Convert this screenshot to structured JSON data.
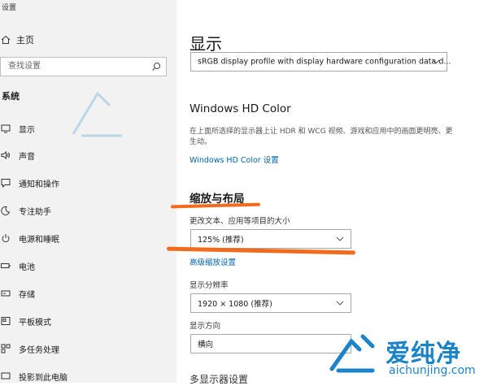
{
  "app_title": "设置",
  "home_label": "主页",
  "search_placeholder": "查找设置",
  "section_title": "系统",
  "nav": [
    {
      "label": "显示",
      "icon": "monitor-icon"
    },
    {
      "label": "声音",
      "icon": "speaker-icon"
    },
    {
      "label": "通知和操作",
      "icon": "notification-icon"
    },
    {
      "label": "专注助手",
      "icon": "moon-icon"
    },
    {
      "label": "电源和睡眠",
      "icon": "power-icon"
    },
    {
      "label": "电池",
      "icon": "battery-icon"
    },
    {
      "label": "存储",
      "icon": "storage-icon"
    },
    {
      "label": "平板模式",
      "icon": "tablet-icon"
    },
    {
      "label": "多任务处理",
      "icon": "multitask-icon"
    },
    {
      "label": "投影到此电脑",
      "icon": "project-icon"
    }
  ],
  "main": {
    "title": "显示",
    "color_profile_value": "sRGB display profile with display hardware configuration data d...",
    "hd_color_heading": "Windows HD Color",
    "hd_color_desc": "在上面所选择的显示器上让 HDR 和 WCG 视频、游戏和应用中的画面更明亮、更生动。",
    "hd_color_link": "Windows HD Color 设置",
    "scale_heading": "缩放与布局",
    "scale_label": "更改文本、应用等项目的大小",
    "scale_value": "125% (推荐)",
    "advanced_scaling_link": "高级缩放设置",
    "resolution_label": "显示分辨率",
    "resolution_value": "1920 × 1080 (推荐)",
    "orientation_label": "显示方向",
    "orientation_value": "横向",
    "multi_display_heading": "多显示器设置"
  },
  "watermark": {
    "cn": "爱纯净",
    "en": "aichunjing.com"
  },
  "colors": {
    "accent_link": "#0063b1",
    "highlight": "#f26a1b",
    "watermark": "#1b84c7"
  }
}
